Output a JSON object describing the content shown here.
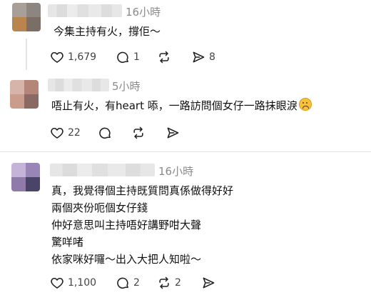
{
  "posts": [
    {
      "time": "16小時",
      "lines": [
        "今集主持有火，撐佢～"
      ],
      "likes": "1,679",
      "comments": "1",
      "reposts": "",
      "shares": "8"
    },
    {
      "time": "5小時",
      "lines": [
        "唔止有火，有heart 㖭，一路訪問個女仔一路抹眼淚"
      ],
      "likes": "22",
      "comments": "",
      "reposts": "",
      "shares": ""
    },
    {
      "time": "16小時",
      "lines": [
        "真，我覺得個主持既質問真係做得好好",
        "兩個夾份呃個女仔錢",
        "仲好意思叫主持唔好講野咁大聲",
        "驚咩啫",
        "依家咪好囉～出入大把人知啦～"
      ],
      "likes": "1,100",
      "comments": "2",
      "reposts": "2",
      "shares": ""
    }
  ],
  "icons": {
    "like": "heart-icon",
    "comment": "comment-icon",
    "repost": "repost-icon",
    "share": "share-icon",
    "emoji": "crying-face-emoji-icon"
  }
}
